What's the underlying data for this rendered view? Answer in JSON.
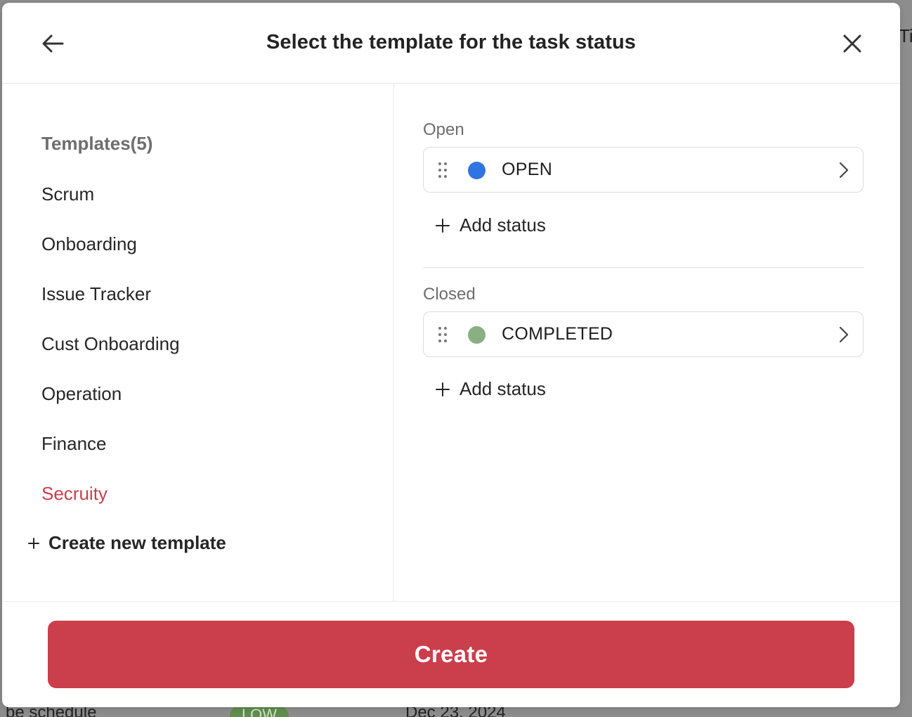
{
  "background": {
    "peek_title": "Ti",
    "row": {
      "task_text": "be schedule",
      "priority_badge": "LOW",
      "date": "Dec 23, 2024"
    }
  },
  "modal": {
    "title": "Select the template for the task status",
    "back_icon": "arrow-left-icon",
    "close_icon": "close-icon"
  },
  "templates": {
    "heading": "Templates(5)",
    "items": [
      {
        "label": "Scrum",
        "active": false
      },
      {
        "label": "Onboarding",
        "active": false
      },
      {
        "label": "Issue Tracker",
        "active": false
      },
      {
        "label": "Cust Onboarding",
        "active": false
      },
      {
        "label": "Operation",
        "active": false
      },
      {
        "label": "Finance",
        "active": false
      },
      {
        "label": "Secruity",
        "active": true
      }
    ],
    "create_new_label": "Create new template",
    "active_color": "#cb3e4b"
  },
  "status_groups": {
    "open": {
      "label": "Open",
      "statuses": [
        {
          "name": "OPEN",
          "color": "#2f74e0"
        }
      ],
      "add_label": "Add status"
    },
    "closed": {
      "label": "Closed",
      "statuses": [
        {
          "name": "COMPLETED",
          "color": "#8aaf82"
        }
      ],
      "add_label": "Add status"
    }
  },
  "footer": {
    "create_label": "Create",
    "button_color": "#cb3e4b"
  }
}
